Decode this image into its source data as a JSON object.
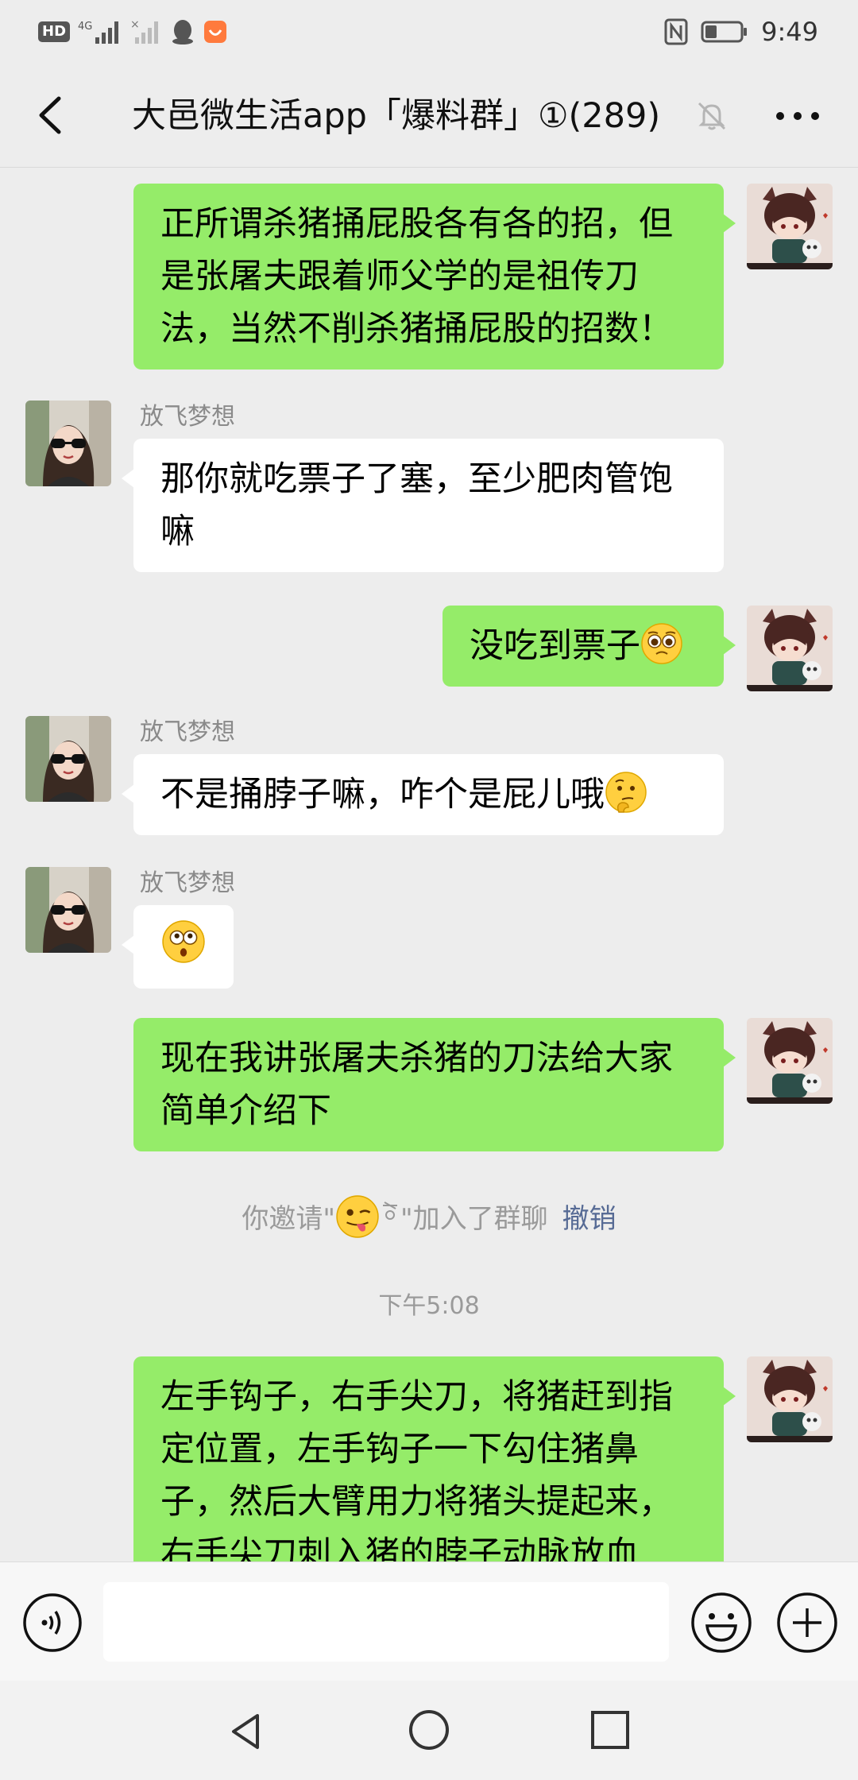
{
  "status_bar": {
    "hd_label": "HD",
    "network_label": "4G",
    "time": "9:49"
  },
  "header": {
    "title": "大邑微生活app「爆料群」①(289)"
  },
  "messages": [
    {
      "from": "me",
      "text": "正所谓杀猪捅屁股各有各的招，但是张屠夫跟着师父学的是祖传刀法，当然不削杀猪捅屁股的招数！"
    },
    {
      "from": "other",
      "sender": "放飞梦想",
      "text": "那你就吃票子了塞，至少肥肉管饱嘛"
    },
    {
      "from": "me",
      "text": "没吃到票子",
      "emoji": "pleading-face"
    },
    {
      "from": "other",
      "sender": "放飞梦想",
      "text": "不是捅脖子嘛，咋个是屁儿哦",
      "emoji": "thinking-face"
    },
    {
      "from": "other",
      "sender": "放飞梦想",
      "text": "",
      "emoji": "flushed-face"
    },
    {
      "from": "me",
      "text": "现在我讲张屠夫杀猪的刀法给大家简单介绍下"
    },
    {
      "from": "me",
      "text": "左手钩子，右手尖刀，将猪赶到指定位置，左手钩子一下勾住猪鼻子，然后大臂用力将猪头提起来，右手尖刀刺入猪的脖子动脉放血"
    }
  ],
  "system_note": {
    "text_before": "你邀请\"",
    "text_after": "\"加入了群聊",
    "invitee_emoji": "winking-tongue-face",
    "revoke_label": "撤销"
  },
  "timestamp": "下午5:08",
  "input": {
    "value": "",
    "placeholder": ""
  },
  "colors": {
    "my_bubble": "#95ec69",
    "other_bubble": "#ffffff",
    "background": "#ededed",
    "link": "#576b95"
  }
}
